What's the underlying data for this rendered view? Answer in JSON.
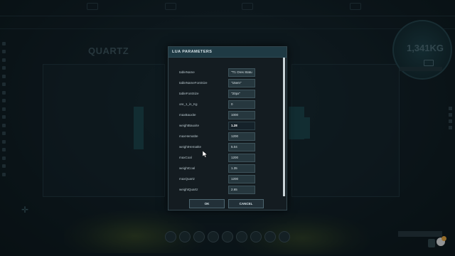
{
  "background": {
    "title": "QUARTZ",
    "gauge_value": "1,341KG"
  },
  "dialog": {
    "title": "LUA PARAMETERS",
    "fields": [
      {
        "label": "tableName",
        "value": "\"T1 Ores Statu"
      },
      {
        "label": "tableNameFontSize",
        "value": "\"15em\""
      },
      {
        "label": "tableFontSize",
        "value": "\"20px\""
      },
      {
        "label": "ore_1_in_Kg",
        "value": "0"
      },
      {
        "label": "maxBauxite",
        "value": "1000"
      },
      {
        "label": "weightBauxite",
        "value": "1.28"
      },
      {
        "label": "maxHematite",
        "value": "1200"
      },
      {
        "label": "weightHematite",
        "value": "5.04"
      },
      {
        "label": "maxCoal",
        "value": "1200"
      },
      {
        "label": "weightCoal",
        "value": "1.35"
      },
      {
        "label": "maxQuartz",
        "value": "1200"
      },
      {
        "label": "weightQuartz",
        "value": "2.65"
      }
    ],
    "ok_label": "OK",
    "cancel_label": "CANCEL"
  },
  "colors": {
    "header": "#1f3a44",
    "dialog_bg": "#141c21",
    "input_bg": "#26373e",
    "accent_glow": "#6e8228"
  }
}
